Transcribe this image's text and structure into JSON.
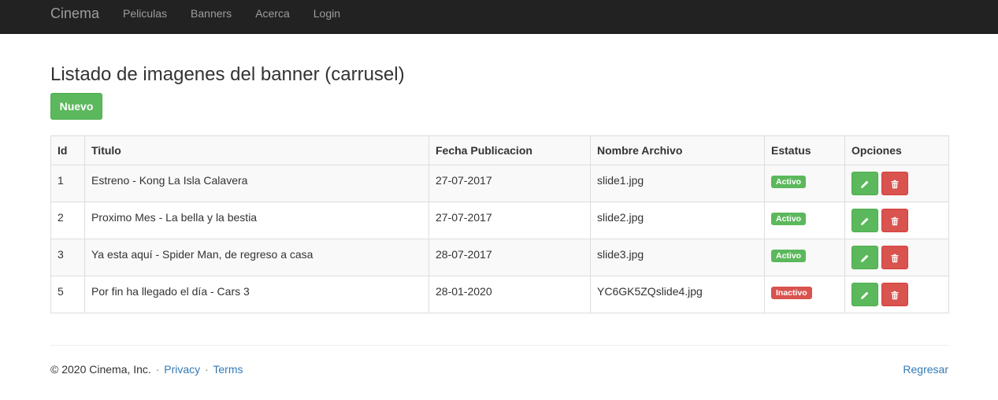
{
  "navbar": {
    "brand": "Cinema",
    "items": [
      {
        "label": "Peliculas"
      },
      {
        "label": "Banners"
      },
      {
        "label": "Acerca"
      },
      {
        "label": "Login"
      }
    ]
  },
  "page": {
    "title": "Listado de imagenes del banner (carrusel)",
    "new_button": "Nuevo"
  },
  "table": {
    "headers": [
      "Id",
      "Titulo",
      "Fecha Publicacion",
      "Nombre Archivo",
      "Estatus",
      "Opciones"
    ],
    "rows": [
      {
        "id": "1",
        "titulo": "Estreno - Kong La Isla Calavera",
        "fecha": "27-07-2017",
        "archivo": "slide1.jpg",
        "estatus": "Activo"
      },
      {
        "id": "2",
        "titulo": "Proximo Mes - La bella y la bestia",
        "fecha": "27-07-2017",
        "archivo": "slide2.jpg",
        "estatus": "Activo"
      },
      {
        "id": "3",
        "titulo": "Ya esta aquí - Spider Man, de regreso a casa",
        "fecha": "28-07-2017",
        "archivo": "slide3.jpg",
        "estatus": "Activo"
      },
      {
        "id": "5",
        "titulo": "Por fin ha llegado el día - Cars 3",
        "fecha": "28-01-2020",
        "archivo": "YC6GK5ZQslide4.jpg",
        "estatus": "Inactivo"
      }
    ]
  },
  "footer": {
    "copyright": "© 2020 Cinema, Inc.",
    "separator": "·",
    "privacy": "Privacy",
    "terms": "Terms",
    "back": "Regresar"
  },
  "icons": {
    "edit": "pencil-icon",
    "delete": "trash-icon"
  },
  "colors": {
    "success": "#5cb85c",
    "danger": "#d9534f",
    "link": "#337ab7",
    "navbar": "#222222"
  }
}
